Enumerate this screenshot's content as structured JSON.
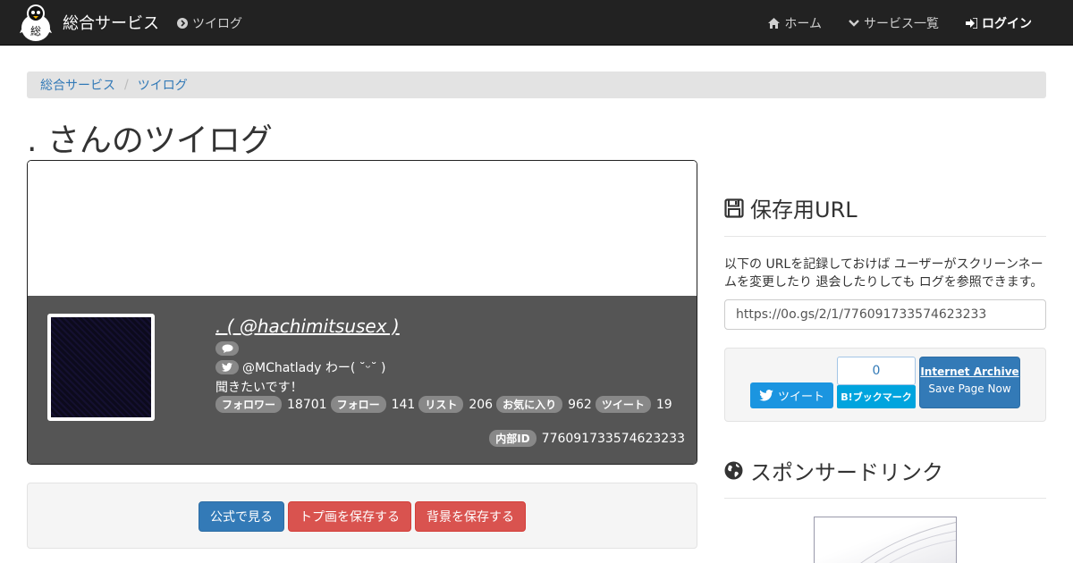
{
  "navbar": {
    "brand": "総合サービス",
    "left_link": "ツイログ",
    "right": {
      "home": "ホーム",
      "services": "サービス一覧",
      "login": "ログイン"
    }
  },
  "breadcrumb": {
    "items": [
      "総合サービス",
      "ツイログ"
    ]
  },
  "page_title": ". さんのツイログ",
  "profile": {
    "name": ". ( @hachimitsusex )",
    "description_line1": "@MChatlady わー( ˘ᵕ˘ )",
    "description_line2": "聞きたいです！",
    "stats": [
      {
        "label": "フォロワー",
        "value": "18701"
      },
      {
        "label": "フォロー",
        "value": "141"
      },
      {
        "label": "リスト",
        "value": "206"
      },
      {
        "label": "お気に入り",
        "value": "962"
      },
      {
        "label": "ツイート",
        "value": "19"
      }
    ],
    "internal_id_label": "内部ID",
    "internal_id": "776091733574623233"
  },
  "actions": {
    "official": "公式で見る",
    "save_icon": "トプ画を保存する",
    "save_bg": "背景を保存する"
  },
  "sidebar": {
    "save_heading": "保存用URL",
    "save_description": "以下の URLを記録しておけば ユーザーがスクリーンネームを変更したり 退会したりしても ログを参照できます。",
    "save_url": "https://0o.gs/2/1/776091733574623233",
    "tweet_button": "ツイート",
    "hatena_count": "0",
    "hatena_button": "B!ブックマーク",
    "archive_title": "Internet Archive",
    "archive_sub": "Save Page Now",
    "sponsor_heading": "スポンサードリンク"
  },
  "colors": {
    "navbar": "#222222",
    "primary": "#337ab7",
    "danger": "#d9534f",
    "twitter": "#1b95e0",
    "hatena": "#00a4de",
    "profile_bg": "#555555"
  }
}
